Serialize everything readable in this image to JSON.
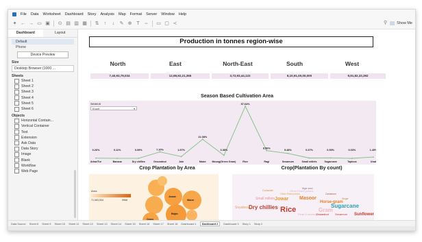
{
  "menu": {
    "items": [
      "File",
      "Data",
      "Worksheet",
      "Dashboard",
      "Story",
      "Analysis",
      "Map",
      "Format",
      "Server",
      "Window",
      "Help"
    ]
  },
  "toolbar": {
    "show_me_label": "Show Me"
  },
  "sidebar": {
    "tabs": [
      "Dashboard",
      "Layout"
    ],
    "device_header": "",
    "devices": [
      "Default",
      "Phone"
    ],
    "device_preview_button": "Device Preview",
    "size_header": "Size",
    "size_value": "Desktop Browser (1000 ...",
    "sheets_header": "Sheets",
    "sheets": [
      "Sheet 1",
      "Sheet 2",
      "Sheet 3",
      "Sheet 4",
      "Sheet 5",
      "Sheet 6"
    ],
    "objects_header": "Objects",
    "objects": [
      "Horizontal Contain...",
      "Vertical Container",
      "Text",
      "Extension",
      "Ask Data",
      "Data Story",
      "Image",
      "Blank",
      "Workflow",
      "Web Page"
    ]
  },
  "dashboard": {
    "title": "Production in tonnes region-wise",
    "regions": [
      {
        "name": "North",
        "value": "7,40,93,79,034"
      },
      {
        "name": "East",
        "value": "12,98,92,21,365"
      },
      {
        "name": "North-East",
        "value": "3,72,93,44,122"
      },
      {
        "name": "South",
        "value": "8,10,91,00,00,000"
      },
      {
        "name": "West",
        "value": "9,91,82,33,392"
      }
    ],
    "season_title": "Season Based Cultivation  Area",
    "season_filter_label": "Season",
    "season_filter_value": "Kharif",
    "crop_area_title": "Crop Plantation by Area",
    "crop_count_title": "Crop(Plantation By count)",
    "area_legend_label": "Area",
    "area_legend_min": "71,063,534",
    "area_legend_max": "9968",
    "bubbles": [
      "Jowar",
      "Maize",
      "Bajra",
      "Gram"
    ]
  },
  "chart_data": {
    "type": "line",
    "title": "Season Based Cultivation  Area",
    "categories": [
      "Arhar/Tur",
      "Banana",
      "Dry chillies",
      "Groundnut",
      "Jute",
      "Maize",
      "Moong(Green Gram)",
      "Rice",
      "Ragi",
      "Sesamum",
      "Small millets",
      "Sugarcane",
      "Tapioca",
      "Urad"
    ],
    "series": [
      {
        "values": [
          0.26,
          0.11,
          0.09,
          7.1,
          1.97,
          21.08,
          3.38,
          57.64,
          8.56,
          5.48,
          0.37,
          0.5,
          0.03,
          1.45
        ]
      }
    ],
    "labels": [
      "0.26%",
      "0.11%",
      "0.09%",
      "7.10%",
      "1.97%",
      "21.08%",
      "3.38%",
      "57.64%",
      "8.56%",
      "5.48%",
      "0.37%",
      "0.50%",
      "0.03%",
      "1.45%"
    ],
    "unit": "%",
    "line_color": "#7fbf7f"
  },
  "word_cloud": [
    {
      "t": "Dry chillies",
      "c": "#c0392b",
      "s": 8
    },
    {
      "t": "Rice",
      "c": "#c0392b",
      "s": 11
    },
    {
      "t": "Jowar",
      "c": "#e69a3a",
      "s": 7
    },
    {
      "t": "Masoor",
      "c": "#e67e22",
      "s": 7
    },
    {
      "t": "Gram",
      "c": "#f2b8b8",
      "s": 8
    },
    {
      "t": "Sugarcane",
      "c": "#27a0b5",
      "s": 8
    },
    {
      "t": "Sunflower",
      "c": "#c0392b",
      "s": 6
    },
    {
      "t": "Horse-gram",
      "c": "#e67e22",
      "s": 6
    },
    {
      "t": "Small millets",
      "c": "#f08a9a",
      "s": 5
    },
    {
      "t": "Soyabean",
      "c": "#e0a060",
      "s": 5
    },
    {
      "t": "Other Kharif pulses",
      "c": "#e0b0d0",
      "s": 4
    },
    {
      "t": "Peas & beans (Pulses)",
      "c": "#e0b0b0",
      "s": 4
    },
    {
      "t": "Other Rabi pulses",
      "c": "#e6a040",
      "s": 3.6
    },
    {
      "t": "Coriander",
      "c": "#d08c3a",
      "s": 3.6
    },
    {
      "t": "Niger seed",
      "c": "#777777",
      "s": 3.2
    },
    {
      "t": "Cardamom",
      "c": "#a06040",
      "s": 3.2
    },
    {
      "t": "Ginger",
      "c": "#c08040",
      "s": 3.2
    },
    {
      "t": "Sesamum",
      "c": "#c0392b",
      "s": 4
    },
    {
      "t": "Groundnut",
      "c": "#c0392b",
      "s": 4
    }
  ],
  "sheet_tabs": [
    "Data Source",
    "Sheet 8",
    "Sheet 9",
    "Sheet 10",
    "Sheet 11",
    "Sheet 12",
    "Sheet 13",
    "Sheet 14",
    "Sheet 15",
    "Sheet 16",
    "Sheet 17",
    "Sheet 18",
    "Dashboard 1",
    "Dashboard 2",
    "Dashboard 3",
    "Story 1",
    "Story 2"
  ],
  "active_sheet": "Dashboard 2"
}
